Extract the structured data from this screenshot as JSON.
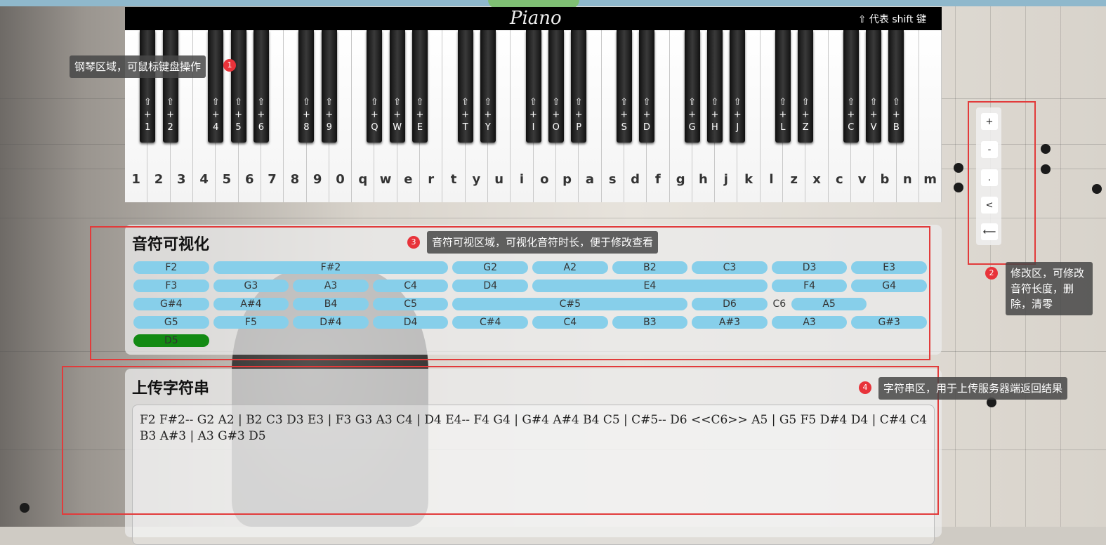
{
  "piano": {
    "title": "Piano",
    "shift_hint": "⇧ 代表 shift 键",
    "white_keys": [
      "1",
      "2",
      "3",
      "4",
      "5",
      "6",
      "7",
      "8",
      "9",
      "0",
      "q",
      "w",
      "e",
      "r",
      "t",
      "y",
      "u",
      "i",
      "o",
      "p",
      "a",
      "s",
      "d",
      "f",
      "g",
      "h",
      "j",
      "k",
      "l",
      "z",
      "x",
      "c",
      "v",
      "b",
      "n",
      "m"
    ],
    "black_keys": [
      "1",
      "2",
      "4",
      "5",
      "6",
      "8",
      "9",
      "Q",
      "W",
      "E",
      "T",
      "Y",
      "I",
      "O",
      "P",
      "S",
      "D",
      "G",
      "H",
      "J",
      "L",
      "Z",
      "C",
      "V",
      "B"
    ],
    "black_key_prefix": "⇧\n+"
  },
  "visual": {
    "title": "音符可视化",
    "rows": [
      [
        {
          "n": "F2",
          "s": 1
        },
        {
          "n": "F#2",
          "s": 3
        },
        {
          "n": "G2",
          "s": 1
        },
        {
          "n": "A2",
          "s": 1
        },
        {
          "n": "B2",
          "s": 1
        },
        {
          "n": "C3",
          "s": 1
        },
        {
          "n": "D3",
          "s": 1
        },
        {
          "n": "E3",
          "s": 1
        }
      ],
      [
        {
          "n": "F3",
          "s": 1
        },
        {
          "n": "G3",
          "s": 1
        },
        {
          "n": "A3",
          "s": 1
        },
        {
          "n": "C4",
          "s": 1
        },
        {
          "n": "D4",
          "s": 1
        },
        {
          "n": "E4",
          "s": 3
        },
        {
          "n": "F4",
          "s": 1
        },
        {
          "n": "G4",
          "s": 1
        }
      ],
      [
        {
          "n": "G#4",
          "s": 1
        },
        {
          "n": "A#4",
          "s": 1
        },
        {
          "n": "B4",
          "s": 1
        },
        {
          "n": "C5",
          "s": 1
        },
        {
          "n": "C#5",
          "s": 3
        },
        {
          "n": "D6",
          "s": 1
        },
        {
          "n": "C6",
          "s": 0.2
        },
        {
          "n": "A5",
          "s": 1
        }
      ],
      [
        {
          "n": "G5",
          "s": 1
        },
        {
          "n": "F5",
          "s": 1
        },
        {
          "n": "D#4",
          "s": 1
        },
        {
          "n": "D4",
          "s": 1
        },
        {
          "n": "C#4",
          "s": 1
        },
        {
          "n": "C4",
          "s": 1
        },
        {
          "n": "B3",
          "s": 1
        },
        {
          "n": "A#3",
          "s": 1
        },
        {
          "n": "A3",
          "s": 1
        },
        {
          "n": "G#3",
          "s": 1
        }
      ],
      [
        {
          "n": "D5",
          "s": 1,
          "active": true
        }
      ]
    ],
    "active_color": "#138a13",
    "note_color": "#87cfea"
  },
  "upload": {
    "title": "上传字符串",
    "content": "F2 F#2-- G2 A2 | B2 C3 D3 E3 | F3 G3 A3 C4 | D4 E4-- F4 G4 | G#4 A#4 B4 C5 | C#5-- D6 <<C6>> A5 | G5 F5 D#4 D4 | C#4 C4 B3 A#3 | A3 G#3 D5"
  },
  "edit": {
    "buttons": [
      "+",
      "-",
      ".",
      "<",
      "⟵"
    ]
  },
  "annotations": {
    "a1": {
      "badge": "1",
      "text": "钢琴区域，可鼠标键盘操作"
    },
    "a2": {
      "badge": "2",
      "text": "修改区，可修改音符长度，删除，清零"
    },
    "a3": {
      "badge": "3",
      "text": "音符可视区域，可视化音符时长，便于修改查看"
    },
    "a4": {
      "badge": "4",
      "text": "字符串区，用于上传服务器端返回结果"
    },
    "color": "#e23b3b"
  }
}
